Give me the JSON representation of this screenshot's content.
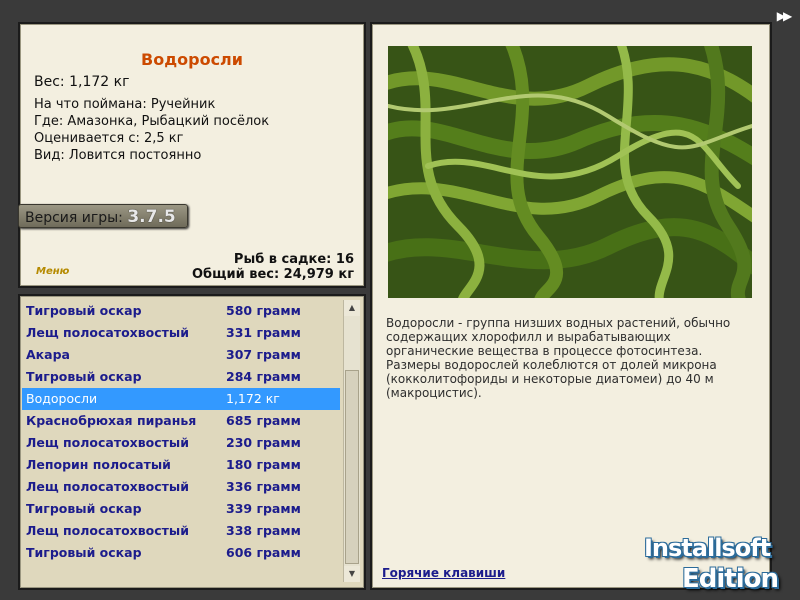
{
  "info": {
    "title": "Водоросли",
    "weight": "Вес: 1,172 кг",
    "caught_with": "На что поймана: Ручейник",
    "location": "Где: Амазонка, Рыбацкий посёлок",
    "valued_from": "Оценивается с: 2,5 кг",
    "kind": "Вид: Ловится постоянно",
    "version_label": "Версия игры:",
    "version_number": "3.7.5",
    "menu_link": "Меню",
    "fish_in_cage": "Рыб в садке: 16",
    "total_weight": "Общий вес: 24,979 кг"
  },
  "catch_list": [
    {
      "name": "Тигровый оскар",
      "weight": "580 грамм"
    },
    {
      "name": "Лещ полосатохвостый",
      "weight": "331 грамм"
    },
    {
      "name": "Акара",
      "weight": "307 грамм"
    },
    {
      "name": "Тигровый оскар",
      "weight": "284 грамм"
    },
    {
      "name": "Водоросли",
      "weight": "1,172 кг",
      "selected": true
    },
    {
      "name": "Краснобрюхая пиранья",
      "weight": "685 грамм"
    },
    {
      "name": "Лещ полосатохвостый",
      "weight": "230 грамм"
    },
    {
      "name": "Лепорин полосатый",
      "weight": "180 грамм"
    },
    {
      "name": "Лещ полосатохвостый",
      "weight": "336 грамм"
    },
    {
      "name": "Тигровый оскар",
      "weight": "339 грамм"
    },
    {
      "name": "Лещ полосатохвостый",
      "weight": "338 грамм"
    },
    {
      "name": "Тигровый оскар",
      "weight": "606 грамм"
    }
  ],
  "description": "Водоросли - группа низших водных растений, обычно содержащих хлорофилл и вырабатывающих органические вещества в процессе фотосинтеза. Размеры водорослей колеблются от долей микрона (кокколитофориды и некоторые диатомеи) до 40 м (макроцистис).",
  "hotkeys_link": "Горячие клавиши",
  "watermark": {
    "line1": "Installsoft",
    "line2": "Edition"
  },
  "colors": {
    "selected_row": "#3399ff",
    "title": "#cc4a00",
    "list_text": "#1c1c8c"
  }
}
